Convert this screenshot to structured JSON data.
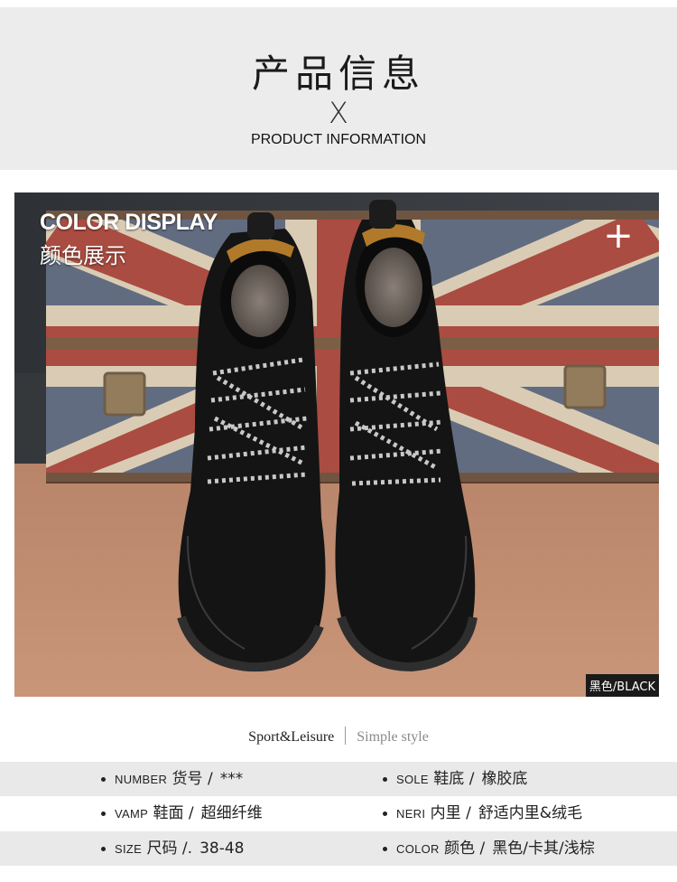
{
  "header": {
    "title_cn": "产品信息",
    "cross": "X",
    "title_en": "PRODUCT INFORMATION"
  },
  "photo": {
    "label_en": "COLOR DISPLAY",
    "label_cn": "颜色展示",
    "plus_icon": "plus-icon",
    "color_tag": "黑色/BLACK"
  },
  "tagline": {
    "left": "Sport&Leisure",
    "right": "Simple style"
  },
  "specs": [
    {
      "en": "NUMBER",
      "cn": "货号 /",
      "value": "***"
    },
    {
      "en": "SOLE",
      "cn": "鞋底 /",
      "value": "橡胶底"
    },
    {
      "en": "VAMP",
      "cn": "鞋面 /",
      "value": "超细纤维"
    },
    {
      "en": "NERI",
      "cn": "内里 /",
      "value": "舒适内里&绒毛"
    },
    {
      "en": "SIZE",
      "cn": "尺码 /.",
      "value": "38-48"
    },
    {
      "en": "COLOR",
      "cn": "颜色 /",
      "value": "黑色/卡其/浅棕"
    }
  ],
  "colors": {
    "header_bg": "#ececec",
    "row_gray": "#e9e9e9",
    "shoe": "#141414",
    "flag_red": "#a8322d",
    "flag_blue": "#2f4a78"
  }
}
